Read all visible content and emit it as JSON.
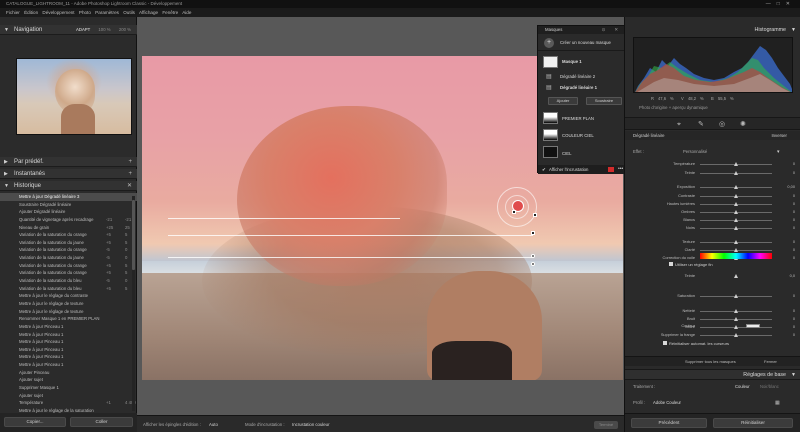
{
  "window": {
    "title": "CATALOGUE_LIGHTROOM_11 - Adobe Photoshop Lightroom Classic - Développement",
    "controls": [
      "—",
      "□",
      "✕"
    ]
  },
  "menubar": [
    "Fichier",
    "Édition",
    "Développement",
    "Photo",
    "Paramètres",
    "Outils",
    "Affichage",
    "Fenêtre",
    "Aide"
  ],
  "left": {
    "navigation": {
      "title": "Navigation",
      "zoom": [
        "ADAPT",
        "100 %",
        "200 %"
      ]
    },
    "presets_title": "Par prédéf.",
    "snapshots_title": "Instantanés",
    "history_title": "Historique",
    "history": [
      {
        "label": "Mettre à jour Dégradé linéaire 3",
        "v1": "",
        "v2": ""
      },
      {
        "label": "Soustraire Dégradé linéaire",
        "v1": "",
        "v2": ""
      },
      {
        "label": "Ajouter Dégradé linéaire",
        "v1": "",
        "v2": ""
      },
      {
        "label": "Quantité de vignetage après recadrage",
        "v1": "-21",
        "v2": "-21"
      },
      {
        "label": "Niveau de grain",
        "v1": "+25",
        "v2": "25"
      },
      {
        "label": "Variation de la saturation du orange",
        "v1": "+5",
        "v2": "5"
      },
      {
        "label": "Variation de la saturation du jaune",
        "v1": "+5",
        "v2": "5"
      },
      {
        "label": "Variation de la saturation du orange",
        "v1": "-5",
        "v2": "0"
      },
      {
        "label": "Variation de la saturation du jaune",
        "v1": "-5",
        "v2": "0"
      },
      {
        "label": "Variation de la saturation du orange",
        "v1": "+5",
        "v2": "5"
      },
      {
        "label": "Variation de la saturation du orange",
        "v1": "+5",
        "v2": "5"
      },
      {
        "label": "Variation de la saturation du bleu",
        "v1": "-5",
        "v2": "0"
      },
      {
        "label": "Variation de la saturation du bleu",
        "v1": "+5",
        "v2": "5"
      },
      {
        "label": "Mettre à jour le réglage du contraste",
        "v1": "",
        "v2": ""
      },
      {
        "label": "Mettre à jour le réglage de texture",
        "v1": "",
        "v2": ""
      },
      {
        "label": "Mettre à jour le réglage de texture",
        "v1": "",
        "v2": ""
      },
      {
        "label": "Renommer Masque 1 en PREMIER PLAN",
        "v1": "",
        "v2": ""
      },
      {
        "label": "Mettre à jour Pinceau 1",
        "v1": "",
        "v2": ""
      },
      {
        "label": "Mettre à jour Pinceau 1",
        "v1": "",
        "v2": ""
      },
      {
        "label": "Mettre à jour Pinceau 1",
        "v1": "",
        "v2": ""
      },
      {
        "label": "Mettre à jour Pinceau 1",
        "v1": "",
        "v2": ""
      },
      {
        "label": "Mettre à jour Pinceau 1",
        "v1": "",
        "v2": ""
      },
      {
        "label": "Mettre à jour Pinceau 1",
        "v1": "",
        "v2": ""
      },
      {
        "label": "Ajouter Pinceau",
        "v1": "",
        "v2": ""
      },
      {
        "label": "Ajouter sujet",
        "v1": "",
        "v2": ""
      },
      {
        "label": "Supprimer Masque 1",
        "v1": "",
        "v2": ""
      },
      {
        "label": "Ajouter sujet",
        "v1": "",
        "v2": ""
      },
      {
        "label": "Température",
        "v1": "+1",
        "v2": "4 400"
      },
      {
        "label": "Mettre à jour le réglage de la saturation",
        "v1": "",
        "v2": ""
      }
    ],
    "copy_btn": "Copier...",
    "paste_btn": "Coller"
  },
  "center": {
    "show_pins_label": "Afficher les épingles d'édition :",
    "show_pins_value": "Auto",
    "overlay_mode_label": "Mode d'incrustation :",
    "overlay_mode_value": "Incrustation couleur",
    "done_btn": "Terminé"
  },
  "masks": {
    "title": "Masques",
    "create_new": "Créer un nouveau masque",
    "mask1": "Masque 1",
    "grad2": "Dégradé linéaire 2",
    "grad1": "Dégradé linéaire 1",
    "add": "Ajouter",
    "subtract": "Soustraire",
    "foreground": "PREMIER PLAN",
    "sky_color": "COULEUR CIEL",
    "sky": "CIEL",
    "show_overlay": "Afficher l'incrustation",
    "overlay_color": "#d12b2b"
  },
  "right": {
    "histogram_title": "Histogramme",
    "histogram": {
      "R": "R",
      "r_val": "47,6",
      "V": "V",
      "v_val": "48,2",
      "B": "B",
      "b_val": "55,5",
      "unit": "%"
    },
    "original_note": "Photo d'origine + aperçu dynamique",
    "mask_type": "Dégradé linéaire",
    "invert": "Inverser",
    "effect_label": "Effet :",
    "effect_value": "Personnalisé",
    "sliders": [
      {
        "label": "Température",
        "val": "0",
        "pos": 0.5
      },
      {
        "label": "Teinte",
        "val": "0",
        "pos": 0.5
      },
      {
        "label": "Exposition",
        "val": "0,00",
        "pos": 0.5
      },
      {
        "label": "Contraste",
        "val": "0",
        "pos": 0.5
      },
      {
        "label": "Hautes lumières",
        "val": "0",
        "pos": 0.5
      },
      {
        "label": "Ombres",
        "val": "0",
        "pos": 0.5
      },
      {
        "label": "Blancs",
        "val": "0",
        "pos": 0.5
      },
      {
        "label": "Noirs",
        "val": "0",
        "pos": 0.5
      },
      {
        "label": "Texture",
        "val": "0",
        "pos": 0.5
      },
      {
        "label": "Clarté",
        "val": "0",
        "pos": 0.5
      },
      {
        "label": "Correction du voile",
        "val": "0",
        "pos": 0.5
      },
      {
        "label": "Teinte",
        "val": "0,0",
        "pos": 0.5
      },
      {
        "label": "Saturation",
        "val": "0",
        "pos": 0.5
      },
      {
        "label": "Netteté",
        "val": "0",
        "pos": 0.5
      },
      {
        "label": "Bruit",
        "val": "0",
        "pos": 0.5
      },
      {
        "label": "Moiré",
        "val": "0",
        "pos": 0.5
      },
      {
        "label": "Supprimer la frange",
        "val": "0",
        "pos": 0.5
      }
    ],
    "fine_adjust": "Utiliser un réglage fin",
    "color_label": "Couleur",
    "reset_auto": "Réinitialiser automat. les curseurs",
    "delete_all": "Supprimer tous les masques",
    "close": "Fermer",
    "basic_title": "Réglages de base",
    "treatment_label": "Traitement :",
    "treatment_color": "Couleur",
    "treatment_bw": "Noir/blanc",
    "profile_label": "Profil :",
    "profile_value": "Adobe Couleur",
    "prev_btn": "Précédent",
    "reset_btn": "Réinitialiser"
  }
}
